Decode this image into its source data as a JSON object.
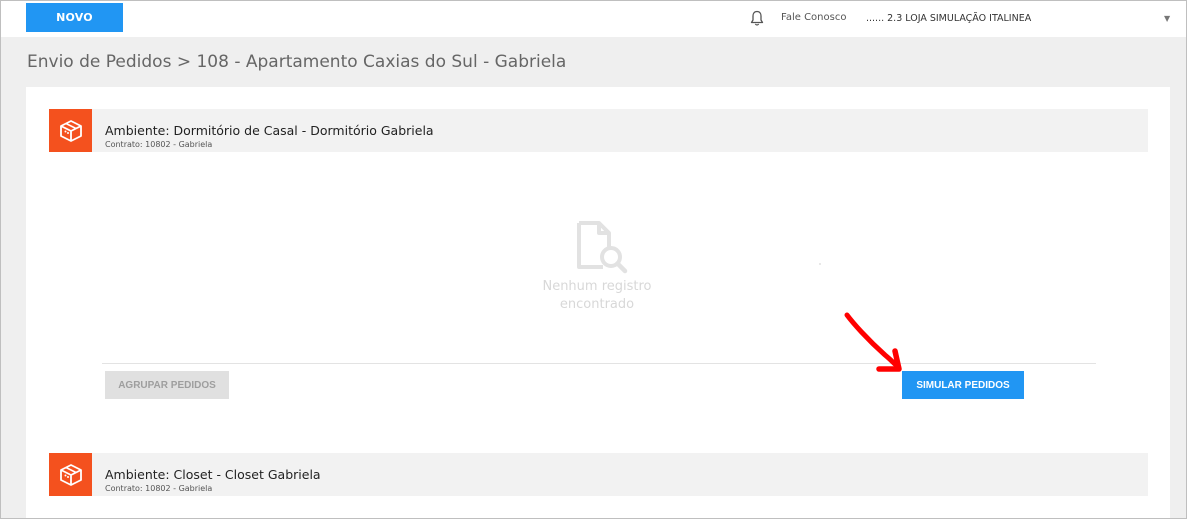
{
  "topbar": {
    "novo_label": "NOVO",
    "fale_conosco": "Fale Conosco",
    "store_selector": "...... 2.3 LOJA SIMULAÇÃO ITALINEA"
  },
  "breadcrumb": "Envio de Pedidos > 108 - Apartamento Caxias do Sul - Gabriela",
  "ambientes": [
    {
      "title": "Ambiente: Dormitório de Casal - Dormitório Gabriela",
      "contract": "Contrato: 10802 - Gabriela"
    },
    {
      "title": "Ambiente: Closet - Closet Gabriela",
      "contract": "Contrato: 10802 - Gabriela"
    }
  ],
  "empty_state": {
    "line1": "Nenhum registro",
    "line2": "encontrado"
  },
  "actions": {
    "agrupar_label": "AGRUPAR PEDIDOS",
    "simular_label": "SIMULAR PEDIDOS"
  },
  "colors": {
    "primary": "#2196f3",
    "accent": "#f4511e",
    "annotation": "#ff0000"
  }
}
